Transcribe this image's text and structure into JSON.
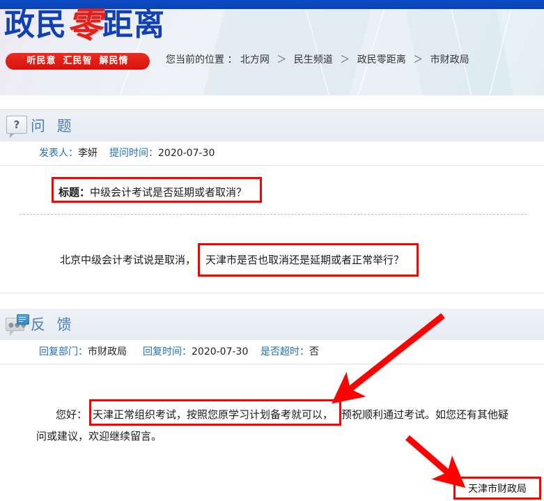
{
  "site": {
    "logo_part1": "政民",
    "logo_part2": "零",
    "logo_part3": "距离",
    "slogan1": "听民意",
    "slogan2": "汇民智",
    "slogan3": "解民情",
    "accent_blue": "#0b47bc",
    "accent_red": "#e2211c",
    "annotation_red": "#ff0000"
  },
  "breadcrumb": {
    "label": "您当前的位置 ：",
    "items": [
      "北方网",
      "民生频道",
      "政民零距离",
      "市财政局"
    ],
    "separator": "＞"
  },
  "question_section": {
    "icon": "question-bubble-icon",
    "heading": "问 题",
    "author_label": "发表人：",
    "author_value": "李妍",
    "time_label": "提问时间：",
    "time_value": "2020-07-30",
    "title_label": "标题：",
    "title_value": "中级会计考试是否延期或者取消？",
    "body_part1": "北京中级会计考试说是取消，",
    "body_part2": "天津市是否也取消还是延期或者正常举行？"
  },
  "feedback_section": {
    "icon": "feedback-bubble-icon",
    "heading": "反 馈",
    "dept_label": "回复部门：",
    "dept_value": "市财政局",
    "time_label": "回复时间：",
    "time_value": "2020-07-30",
    "overtime_label": "是否超时：",
    "overtime_value": "否",
    "reply_greeting": "您好：",
    "reply_highlight": "天津正常组织考试，按照您原学习计划备考就可以，",
    "reply_rest": "预祝顺利通过考试。如您还有其他疑",
    "reply_line2": "问或建议，欢迎继续留言。",
    "signature": "天津市财政局"
  },
  "annotations": {
    "box_title": "标题：中级会计考试是否延期或者取消？",
    "box_question_body": "天津市是否也取消还是延期或者正常举行？",
    "box_reply": "天津正常组织考试，按照您原学习计划备考就可以，",
    "box_signature": "天津市财政局",
    "arrow1": "arrow-pointing-to-reply-highlight",
    "arrow2": "arrow-pointing-to-signature"
  }
}
